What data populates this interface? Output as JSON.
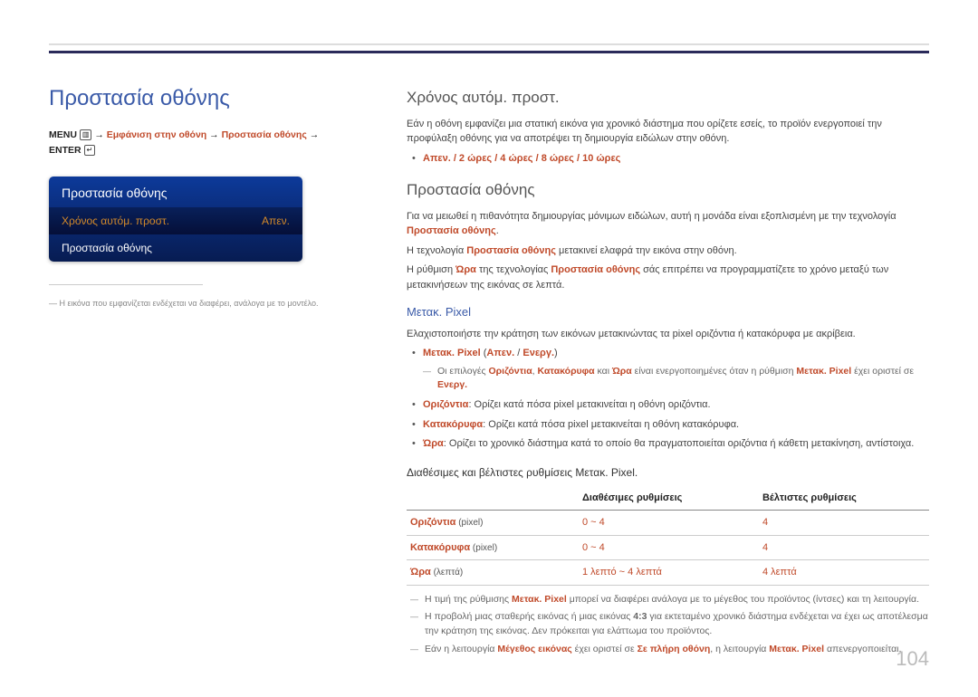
{
  "page_number": "104",
  "left": {
    "main_title": "Προστασία οθόνης",
    "breadcrumb_prefix": "MENU",
    "breadcrumb_menu_icon": "▥",
    "breadcrumb_arrow": " → ",
    "breadcrumb_seg1": "Εμφάνιση στην οθόνη",
    "breadcrumb_seg2": "Προστασία οθόνης",
    "breadcrumb_enter": "ENTER",
    "breadcrumb_enter_icon": "↵",
    "menu": {
      "title": "Προστασία οθόνης",
      "row1_label": "Χρόνος αυτόμ. προστ.",
      "row1_value": "Απεν.",
      "row2_label": "Προστασία οθόνης"
    },
    "footnote_dash": "―",
    "footnote": "Η εικόνα που εμφανίζεται ενδέχεται να διαφέρει, ανάλογα με το μοντέλο."
  },
  "right": {
    "sec1": {
      "title": "Χρόνος αυτόμ. προστ.",
      "p1": "Εάν η οθόνη εμφανίζει μια στατική εικόνα για χρονικό διάστημα που ορίζετε εσείς, το προϊόν ενεργοποιεί την προφύλαξη οθόνης για να αποτρέψει τη δημιουργία ειδώλων στην οθόνη.",
      "bullet": "Απεν. / 2 ώρες / 4 ώρες / 8 ώρες / 10 ώρες"
    },
    "sec2": {
      "title": "Προστασία οθόνης",
      "p1_a": "Για να μειωθεί η πιθανότητα δημιουργίας μόνιμων ειδώλων, αυτή η μονάδα είναι εξοπλισμένη με την τεχνολογία ",
      "p1_hl": "Προστασία οθόνης",
      "p1_b": ".",
      "p2_a": "Η τεχνολογία ",
      "p2_hl": "Προστασία οθόνης",
      "p2_b": " μετακινεί ελαφρά την εικόνα στην οθόνη.",
      "p3_a": "Η ρύθμιση ",
      "p3_hl1": "Ώρα",
      "p3_b": " της τεχνολογίας ",
      "p3_hl2": "Προστασία οθόνης",
      "p3_c": " σάς επιτρέπει να προγραμματίζετε το χρόνο μεταξύ των μετακινήσεων της εικόνας σε λεπτά."
    },
    "pixel": {
      "heading": "Μετακ. Pixel",
      "p1": "Ελαχιστοποιήστε την κράτηση των εικόνων μετακινώντας τα pixel οριζόντια ή κατακόρυφα με ακρίβεια.",
      "b1_label": "Μετακ. Pixel",
      "b1_paren_open": " (",
      "b1_opt1": "Απεν.",
      "b1_slash": " / ",
      "b1_opt2": "Ενεργ.",
      "b1_paren_close": ")",
      "b1_sub_a": "Οι επιλογές ",
      "b1_sub_h1": "Οριζόντια",
      "b1_sub_comma": ", ",
      "b1_sub_h2": "Κατακόρυφα",
      "b1_sub_and": " και ",
      "b1_sub_h3": "Ώρα",
      "b1_sub_b": " είναι ενεργοποιημένες όταν η ρύθμιση ",
      "b1_sub_h4": "Μετακ. Pixel",
      "b1_sub_c": " έχει οριστεί σε ",
      "b1_sub_h5": "Ενεργ.",
      "b2_label": "Οριζόντια",
      "b2_text": ": Ορίζει κατά πόσα pixel μετακινείται η οθόνη οριζόντια.",
      "b3_label": "Κατακόρυφα",
      "b3_text": ": Ορίζει κατά πόσα pixel μετακινείται η οθόνη κατακόρυφα.",
      "b4_label": "Ώρα",
      "b4_text": ": Ορίζει το χρονικό διάστημα κατά το οποίο θα πραγματοποιείται οριζόντια ή κάθετη μετακίνηση, αντίστοιχα.",
      "table_caption": "Διαθέσιμες και βέλτιστες ρυθμίσεις Μετακ. Pixel.",
      "table": {
        "h1": "",
        "h2": "Διαθέσιμες ρυθμίσεις",
        "h3": "Βέλτιστες ρυθμίσεις",
        "r1_label": "Οριζόντια",
        "r1_unit": " (pixel)",
        "r1_avail": "0 ~ 4",
        "r1_best": "4",
        "r2_label": "Κατακόρυφα",
        "r2_unit": " (pixel)",
        "r2_avail": "0 ~ 4",
        "r2_best": "4",
        "r3_label": "Ώρα",
        "r3_unit": " (λεπτά)",
        "r3_avail": "1 λεπτό ~ 4 λεπτά",
        "r3_best": "4 λεπτά"
      },
      "note1_a": "Η τιμή της ρύθμισης ",
      "note1_h": "Μετακ. Pixel",
      "note1_b": " μπορεί να διαφέρει ανάλογα με το μέγεθος του προϊόντος (ίντσες) και τη λειτουργία.",
      "note2_a": "Η προβολή μιας σταθερής εικόνας ή μιας εικόνας ",
      "note2_h": "4:3",
      "note2_b": " για εκτεταμένο χρονικό διάστημα ενδέχεται να έχει ως αποτέλεσμα την κράτηση της εικόνας. Δεν πρόκειται για ελάττωμα του προϊόντος.",
      "note3_a": "Εάν η λειτουργία ",
      "note3_h1": "Μέγεθος εικόνας",
      "note3_b": " έχει οριστεί σε ",
      "note3_h2": "Σε πλήρη οθόνη",
      "note3_c": ", η λειτουργία ",
      "note3_h3": "Μετακ. Pixel",
      "note3_d": " απενεργοποιείται."
    }
  }
}
